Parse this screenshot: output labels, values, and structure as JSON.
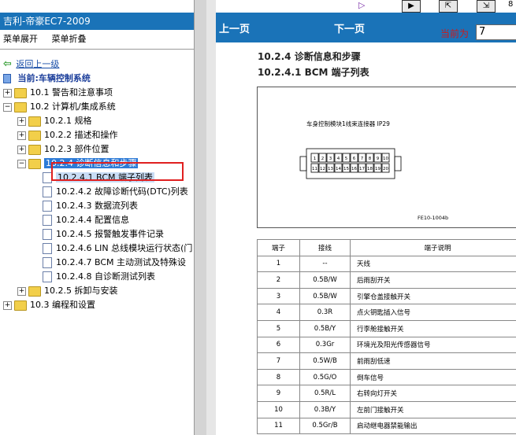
{
  "toolbar": {
    "btn1": "▶",
    "btn2": "⇱",
    "btn3": "⇲",
    "partial_text": "8"
  },
  "left": {
    "title": "吉利-帝豪EC7-2009",
    "menu_expand": "菜单展开",
    "menu_collapse": "菜单折叠",
    "back_link": "返回上一级",
    "current": "当前:车辆控制系统",
    "tree": [
      {
        "label": "10.1 警告和注意事项"
      },
      {
        "label": "10.2 计算机/集成系统"
      },
      {
        "label": "10.2.1 规格"
      },
      {
        "label": "10.2.2 描述和操作"
      },
      {
        "label": "10.2.3 部件位置"
      },
      {
        "label": "10.2.4 诊断信息和步骤"
      },
      {
        "label": "10.2.4.1 BCM 端子列表"
      },
      {
        "label": "10.2.4.2 故障诊断代码(DTC)列表"
      },
      {
        "label": "10.2.4.3 数据流列表"
      },
      {
        "label": "10.2.4.4 配置信息"
      },
      {
        "label": "10.2.4.5 报警触发事件记录"
      },
      {
        "label": "10.2.4.6 LIN 总线模块运行状态(门"
      },
      {
        "label": "10.2.4.7 BCM 主动测试及特殊设"
      },
      {
        "label": "10.2.4.8 自诊断测试列表"
      },
      {
        "label": "10.2.5 拆卸与安装"
      },
      {
        "label": "10.3 编程和设置"
      }
    ]
  },
  "nav": {
    "prev": "上一页",
    "next": "下一页",
    "current_label": "当前为",
    "current_value": "7"
  },
  "doc": {
    "heading1": "10.2.4 诊断信息和步骤",
    "heading2": "10.2.4.1 BCM 端子列表",
    "figure_caption": "车身控制模块1线束连接器 IP29",
    "figure_id": "FE10-1004b",
    "connector_top": [
      "1",
      "2",
      "3",
      "4",
      "5",
      "6",
      "7",
      "8",
      "9",
      "10"
    ],
    "connector_bottom": [
      "11",
      "12",
      "13",
      "14",
      "15",
      "16",
      "17",
      "18",
      "19",
      "20"
    ],
    "table_headers": [
      "端子",
      "接线",
      "端子说明"
    ],
    "table_rows": [
      [
        "1",
        "--",
        "天线"
      ],
      [
        "2",
        "0.5B/W",
        "后雨刮开关"
      ],
      [
        "3",
        "0.5B/W",
        "引擎仓盖接触开关"
      ],
      [
        "4",
        "0.3R",
        "点火钥匙插入信号"
      ],
      [
        "5",
        "0.5B/Y",
        "行李舱接触开关"
      ],
      [
        "6",
        "0.3Gr",
        "环境光及阳光传感器信号"
      ],
      [
        "7",
        "0.5W/B",
        "前雨刮低速"
      ],
      [
        "8",
        "0.5G/O",
        "倒车信号"
      ],
      [
        "9",
        "0.5R/L",
        "右转向灯开关"
      ],
      [
        "10",
        "0.3B/Y",
        "左前门接触开关"
      ],
      [
        "11",
        "0.5Gr/B",
        "启动继电器禁能输出"
      ]
    ]
  }
}
